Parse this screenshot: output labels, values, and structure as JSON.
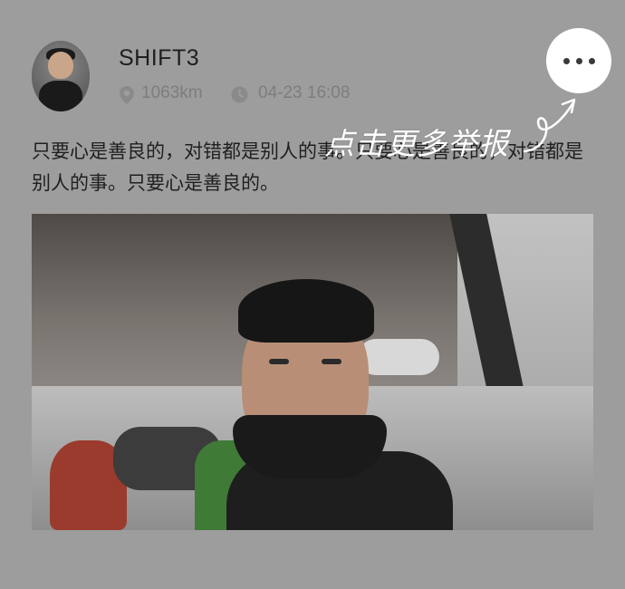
{
  "post": {
    "username": "SHIFT3",
    "distance": "1063km",
    "datetime": "04-23 16:08",
    "content": "只要心是善良的，对错都是别人的事。只要心是善良的，对错都是别人的事。只要心是善良的。"
  },
  "hint": {
    "label": "点击更多举报"
  },
  "icons": {
    "location": "location-pin-icon",
    "time": "clock-icon",
    "more": "more-dots-icon"
  },
  "colors": {
    "overlay": "#9d9d9d",
    "more_button": "#ffffff",
    "hint_text": "#ffffff"
  }
}
